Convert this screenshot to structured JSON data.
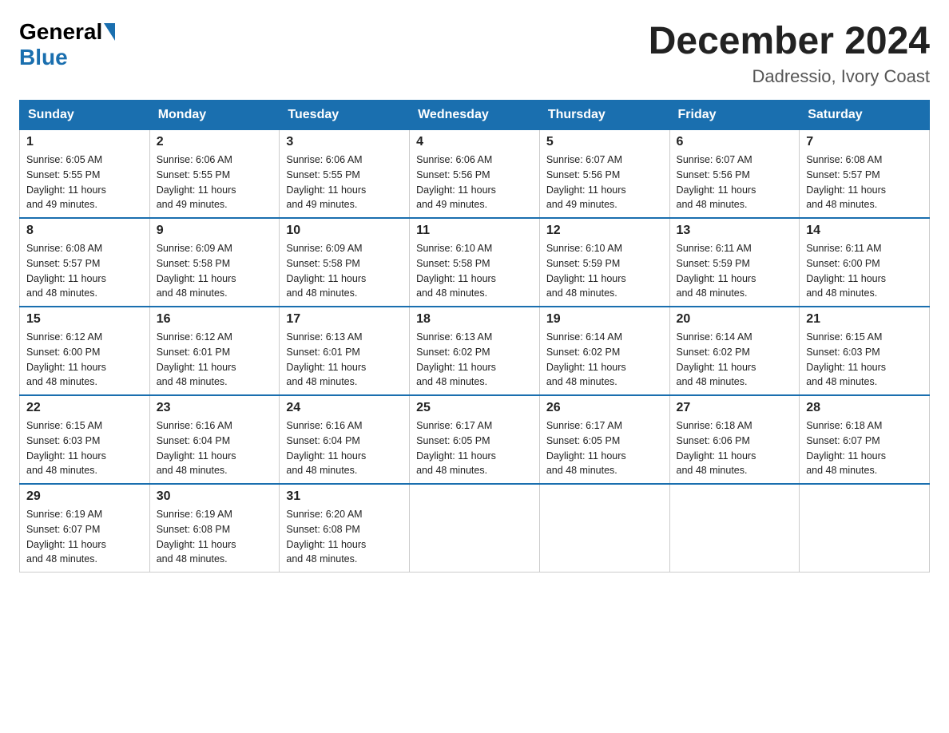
{
  "header": {
    "logo_general": "General",
    "logo_blue": "Blue",
    "month_title": "December 2024",
    "location": "Dadressio, Ivory Coast"
  },
  "weekdays": [
    "Sunday",
    "Monday",
    "Tuesday",
    "Wednesday",
    "Thursday",
    "Friday",
    "Saturday"
  ],
  "weeks": [
    [
      {
        "day": "1",
        "sunrise": "6:05 AM",
        "sunset": "5:55 PM",
        "daylight": "11 hours and 49 minutes."
      },
      {
        "day": "2",
        "sunrise": "6:06 AM",
        "sunset": "5:55 PM",
        "daylight": "11 hours and 49 minutes."
      },
      {
        "day": "3",
        "sunrise": "6:06 AM",
        "sunset": "5:55 PM",
        "daylight": "11 hours and 49 minutes."
      },
      {
        "day": "4",
        "sunrise": "6:06 AM",
        "sunset": "5:56 PM",
        "daylight": "11 hours and 49 minutes."
      },
      {
        "day": "5",
        "sunrise": "6:07 AM",
        "sunset": "5:56 PM",
        "daylight": "11 hours and 49 minutes."
      },
      {
        "day": "6",
        "sunrise": "6:07 AM",
        "sunset": "5:56 PM",
        "daylight": "11 hours and 48 minutes."
      },
      {
        "day": "7",
        "sunrise": "6:08 AM",
        "sunset": "5:57 PM",
        "daylight": "11 hours and 48 minutes."
      }
    ],
    [
      {
        "day": "8",
        "sunrise": "6:08 AM",
        "sunset": "5:57 PM",
        "daylight": "11 hours and 48 minutes."
      },
      {
        "day": "9",
        "sunrise": "6:09 AM",
        "sunset": "5:58 PM",
        "daylight": "11 hours and 48 minutes."
      },
      {
        "day": "10",
        "sunrise": "6:09 AM",
        "sunset": "5:58 PM",
        "daylight": "11 hours and 48 minutes."
      },
      {
        "day": "11",
        "sunrise": "6:10 AM",
        "sunset": "5:58 PM",
        "daylight": "11 hours and 48 minutes."
      },
      {
        "day": "12",
        "sunrise": "6:10 AM",
        "sunset": "5:59 PM",
        "daylight": "11 hours and 48 minutes."
      },
      {
        "day": "13",
        "sunrise": "6:11 AM",
        "sunset": "5:59 PM",
        "daylight": "11 hours and 48 minutes."
      },
      {
        "day": "14",
        "sunrise": "6:11 AM",
        "sunset": "6:00 PM",
        "daylight": "11 hours and 48 minutes."
      }
    ],
    [
      {
        "day": "15",
        "sunrise": "6:12 AM",
        "sunset": "6:00 PM",
        "daylight": "11 hours and 48 minutes."
      },
      {
        "day": "16",
        "sunrise": "6:12 AM",
        "sunset": "6:01 PM",
        "daylight": "11 hours and 48 minutes."
      },
      {
        "day": "17",
        "sunrise": "6:13 AM",
        "sunset": "6:01 PM",
        "daylight": "11 hours and 48 minutes."
      },
      {
        "day": "18",
        "sunrise": "6:13 AM",
        "sunset": "6:02 PM",
        "daylight": "11 hours and 48 minutes."
      },
      {
        "day": "19",
        "sunrise": "6:14 AM",
        "sunset": "6:02 PM",
        "daylight": "11 hours and 48 minutes."
      },
      {
        "day": "20",
        "sunrise": "6:14 AM",
        "sunset": "6:02 PM",
        "daylight": "11 hours and 48 minutes."
      },
      {
        "day": "21",
        "sunrise": "6:15 AM",
        "sunset": "6:03 PM",
        "daylight": "11 hours and 48 minutes."
      }
    ],
    [
      {
        "day": "22",
        "sunrise": "6:15 AM",
        "sunset": "6:03 PM",
        "daylight": "11 hours and 48 minutes."
      },
      {
        "day": "23",
        "sunrise": "6:16 AM",
        "sunset": "6:04 PM",
        "daylight": "11 hours and 48 minutes."
      },
      {
        "day": "24",
        "sunrise": "6:16 AM",
        "sunset": "6:04 PM",
        "daylight": "11 hours and 48 minutes."
      },
      {
        "day": "25",
        "sunrise": "6:17 AM",
        "sunset": "6:05 PM",
        "daylight": "11 hours and 48 minutes."
      },
      {
        "day": "26",
        "sunrise": "6:17 AM",
        "sunset": "6:05 PM",
        "daylight": "11 hours and 48 minutes."
      },
      {
        "day": "27",
        "sunrise": "6:18 AM",
        "sunset": "6:06 PM",
        "daylight": "11 hours and 48 minutes."
      },
      {
        "day": "28",
        "sunrise": "6:18 AM",
        "sunset": "6:07 PM",
        "daylight": "11 hours and 48 minutes."
      }
    ],
    [
      {
        "day": "29",
        "sunrise": "6:19 AM",
        "sunset": "6:07 PM",
        "daylight": "11 hours and 48 minutes."
      },
      {
        "day": "30",
        "sunrise": "6:19 AM",
        "sunset": "6:08 PM",
        "daylight": "11 hours and 48 minutes."
      },
      {
        "day": "31",
        "sunrise": "6:20 AM",
        "sunset": "6:08 PM",
        "daylight": "11 hours and 48 minutes."
      },
      null,
      null,
      null,
      null
    ]
  ],
  "labels": {
    "sunrise": "Sunrise:",
    "sunset": "Sunset:",
    "daylight": "Daylight:"
  }
}
